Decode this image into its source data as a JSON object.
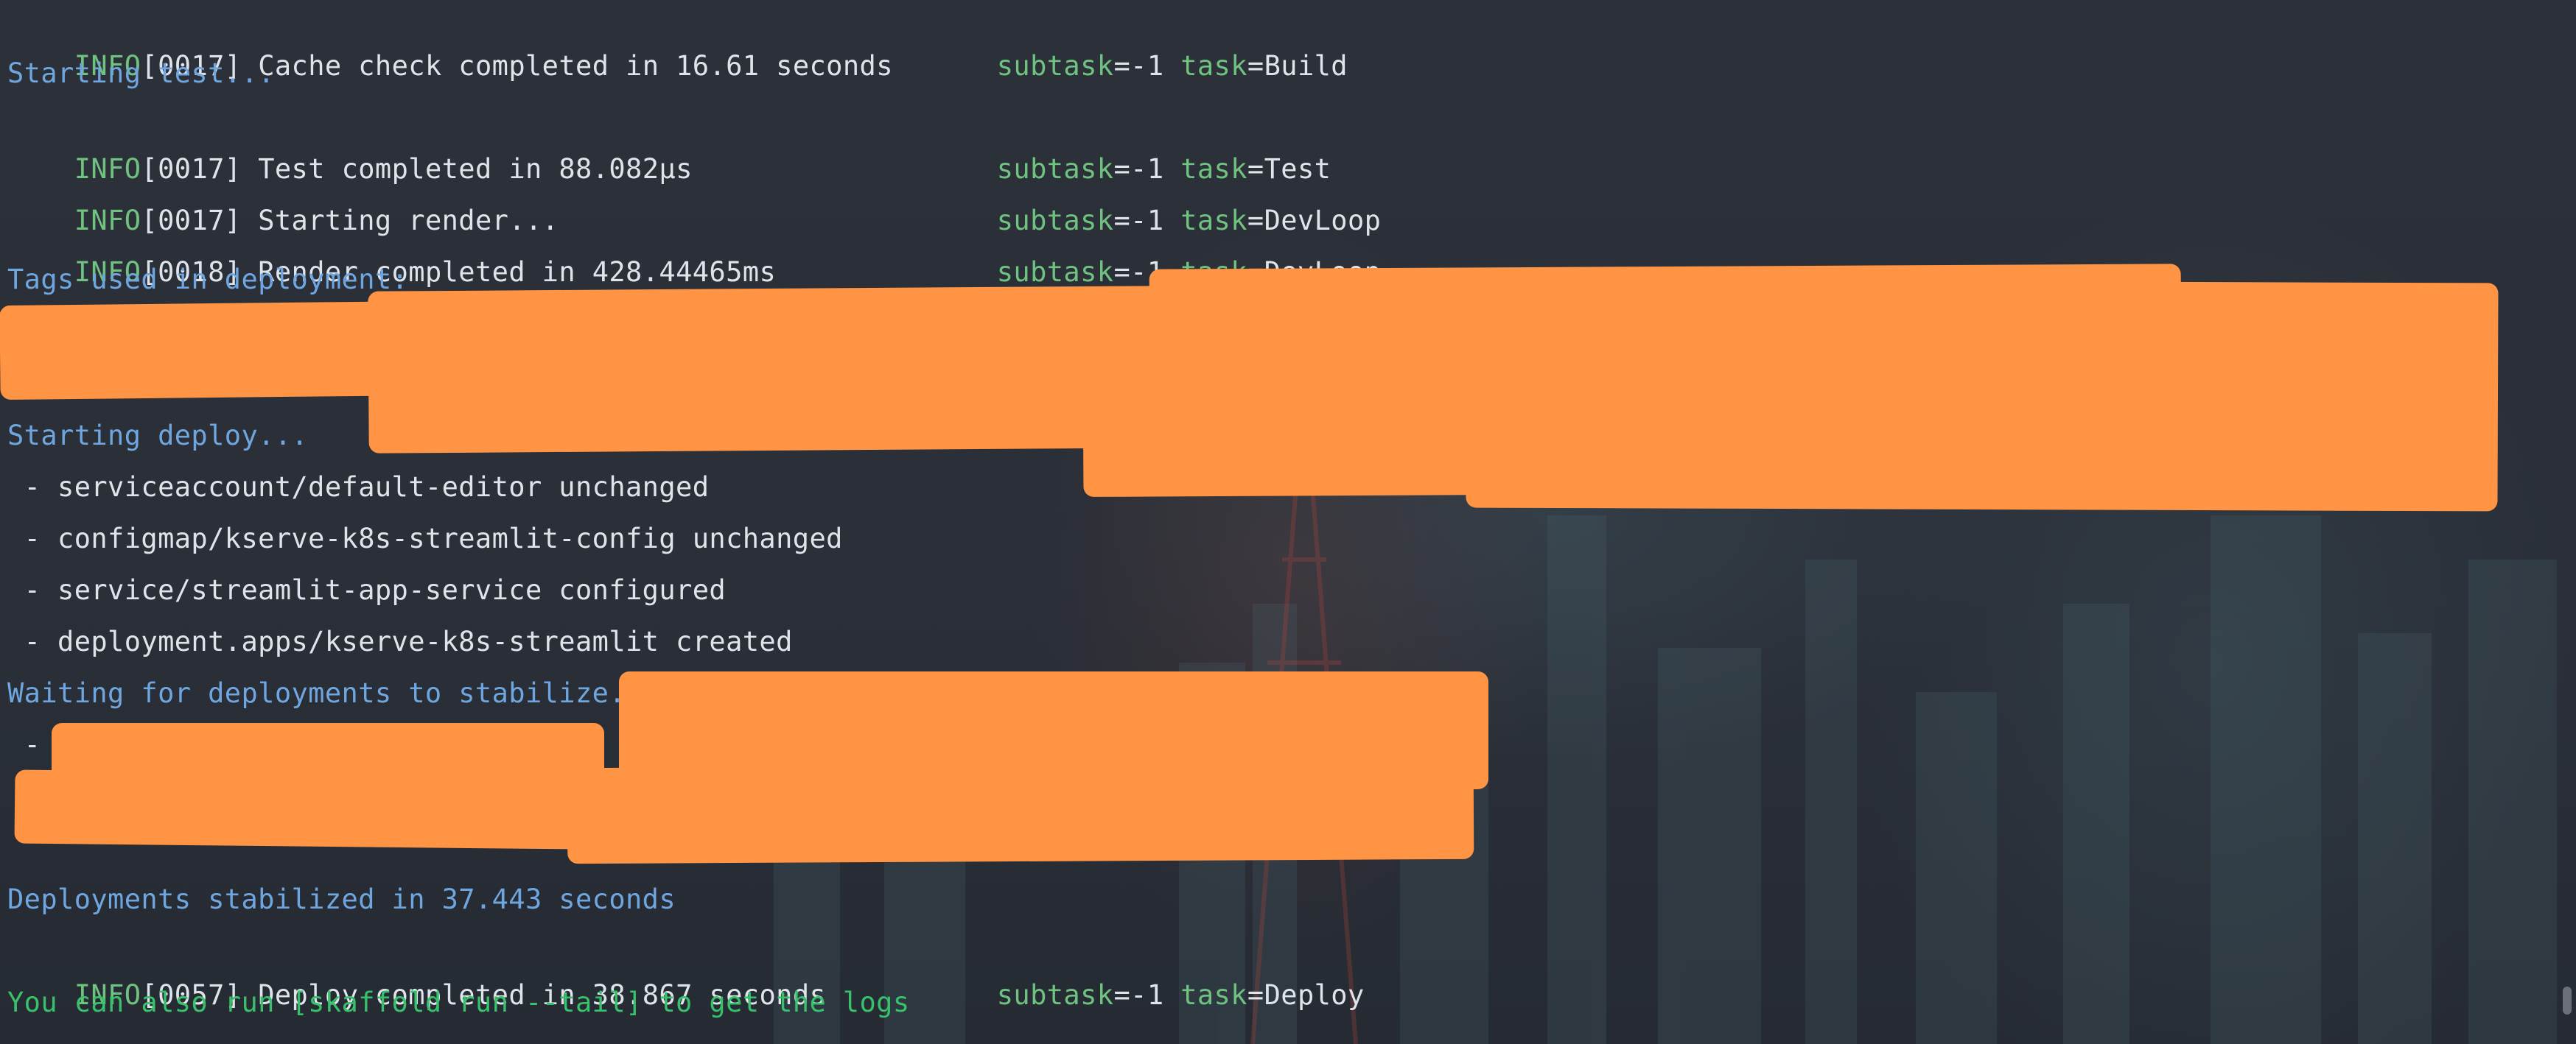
{
  "terminal": {
    "lines": [
      {
        "level": "INFO",
        "code": "[0017]",
        "message": "Cache check completed in 16.61 seconds",
        "subtask_key": "subtask",
        "subtask_val": "-1",
        "task_key": "task",
        "task_val": "Build"
      },
      {
        "text": "Starting test..."
      },
      {
        "level": "INFO",
        "code": "[0017]",
        "message": "Test completed in 88.082µs",
        "subtask_key": "subtask",
        "subtask_val": "-1",
        "task_key": "task",
        "task_val": "Test"
      },
      {
        "level": "INFO",
        "code": "[0017]",
        "message": "Starting render...",
        "subtask_key": "subtask",
        "subtask_val": "-1",
        "task_key": "task",
        "task_val": "DevLoop"
      },
      {
        "level": "INFO",
        "code": "[0018]",
        "message": "Render completed in 428.44465ms",
        "subtask_key": "subtask",
        "subtask_val": "-1",
        "task_key": "task",
        "task_val": "DevLoop"
      },
      {
        "text": "Tags used in deployment:"
      },
      {
        "text": "Starting deploy..."
      },
      {
        "text": " - serviceaccount/default-editor unchanged"
      },
      {
        "text": " - configmap/kserve-k8s-streamlit-config unchanged"
      },
      {
        "text": " - service/streamlit-app-service configured"
      },
      {
        "text": " - deployment.apps/kserve-k8s-streamlit created"
      },
      {
        "text": "Waiting for deployments to stabilize..."
      },
      {
        "text": " - "
      },
      {
        "text": "Deployments stabilized in 37.443 seconds"
      },
      {
        "level": "INFO",
        "code": "[0057]",
        "message": "Deploy completed in 38.867 seconds",
        "subtask_key": "subtask",
        "subtask_val": "-1",
        "task_key": "task",
        "task_val": "Deploy"
      },
      {
        "text": "You can also run [skaffold run --tail] to get the logs"
      }
    ]
  },
  "colors": {
    "info": "#6fc27f",
    "status_blue": "#6fa6df",
    "hint_green": "#38c16b",
    "redaction": "#ff9445",
    "background": "#2b2f3a"
  }
}
